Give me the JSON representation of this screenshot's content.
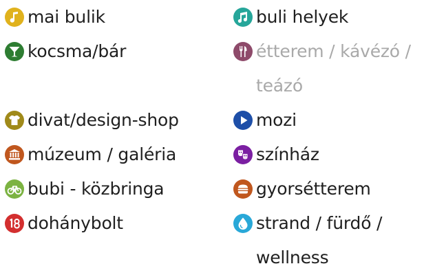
{
  "left_column": {
    "items": [
      {
        "label": "mai bulik",
        "icon": "music-note-icon",
        "color": "#e0b21d"
      },
      {
        "label": "kocsma/bár",
        "icon": "cocktail-glass-icon",
        "color": "#2e7d32"
      },
      {
        "label": "divat/design-shop",
        "icon": "tshirt-icon",
        "color": "#a08a1a"
      },
      {
        "label": "múzeum / galéria",
        "icon": "museum-building-icon",
        "color": "#c0571e"
      },
      {
        "label": "bubi - közbringa",
        "icon": "bicycle-icon",
        "color": "#7cb342"
      },
      {
        "label": "dohánybolt",
        "icon": "age-18-icon",
        "color": "#d32f2f"
      }
    ]
  },
  "right_column": {
    "items": [
      {
        "label": "buli helyek",
        "icon": "music-notes-icon",
        "color": "#26a69a"
      },
      {
        "label": "étterem / kávézó / teázó",
        "icon": "fork-knife-icon",
        "color": "#8e4a6a",
        "muted": true
      },
      {
        "label": "mozi",
        "icon": "play-icon",
        "color": "#1e4fa8"
      },
      {
        "label": "színház",
        "icon": "theater-masks-icon",
        "color": "#7b1fa2"
      },
      {
        "label": "gyorsétterem",
        "icon": "burger-icon",
        "color": "#c0571e"
      },
      {
        "label": "strand / fürdő / wellness",
        "icon": "water-drop-icon",
        "color": "#29a8d8"
      }
    ]
  }
}
